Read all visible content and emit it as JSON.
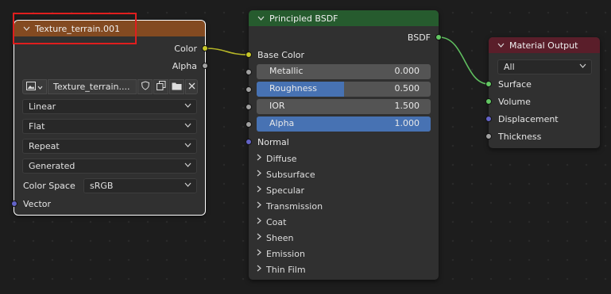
{
  "texture_node": {
    "title": "Texture_terrain.001",
    "outputs": {
      "color": "Color",
      "alpha": "Alpha"
    },
    "image_name": "Texture_terrain....",
    "interpolation": "Linear",
    "projection": "Flat",
    "extension": "Repeat",
    "source": "Generated",
    "color_space_label": "Color Space",
    "color_space_value": "sRGB",
    "input_vector": "Vector",
    "header_color": "#834a21"
  },
  "bsdf_node": {
    "title": "Principled BSDF",
    "output": "BSDF",
    "base_color": "Base Color",
    "sliders": [
      {
        "label": "Metallic",
        "value": "0.000",
        "fraction": 0.0
      },
      {
        "label": "Roughness",
        "value": "0.500",
        "fraction": 0.5
      },
      {
        "label": "IOR",
        "value": "1.500",
        "fraction": 0.0
      },
      {
        "label": "Alpha",
        "value": "1.000",
        "fraction": 1.0
      }
    ],
    "normal": "Normal",
    "panels": [
      "Diffuse",
      "Subsurface",
      "Specular",
      "Transmission",
      "Coat",
      "Sheen",
      "Emission",
      "Thin Film"
    ],
    "header_color": "#265b2e"
  },
  "output_node": {
    "title": "Material Output",
    "target": "All",
    "inputs": [
      "Surface",
      "Volume",
      "Displacement",
      "Thickness"
    ],
    "header_color": "#5a1e2a"
  },
  "colors": {
    "link_yellow": "#c7c729",
    "link_green": "#63c763",
    "slider_fill": "#4772b3",
    "highlight": "#e01e1e"
  },
  "icons": [
    "image-icon",
    "chevron-down-icon",
    "shield-icon",
    "duplicate-icon",
    "folder-icon",
    "close-icon",
    "chevron-right-icon"
  ]
}
